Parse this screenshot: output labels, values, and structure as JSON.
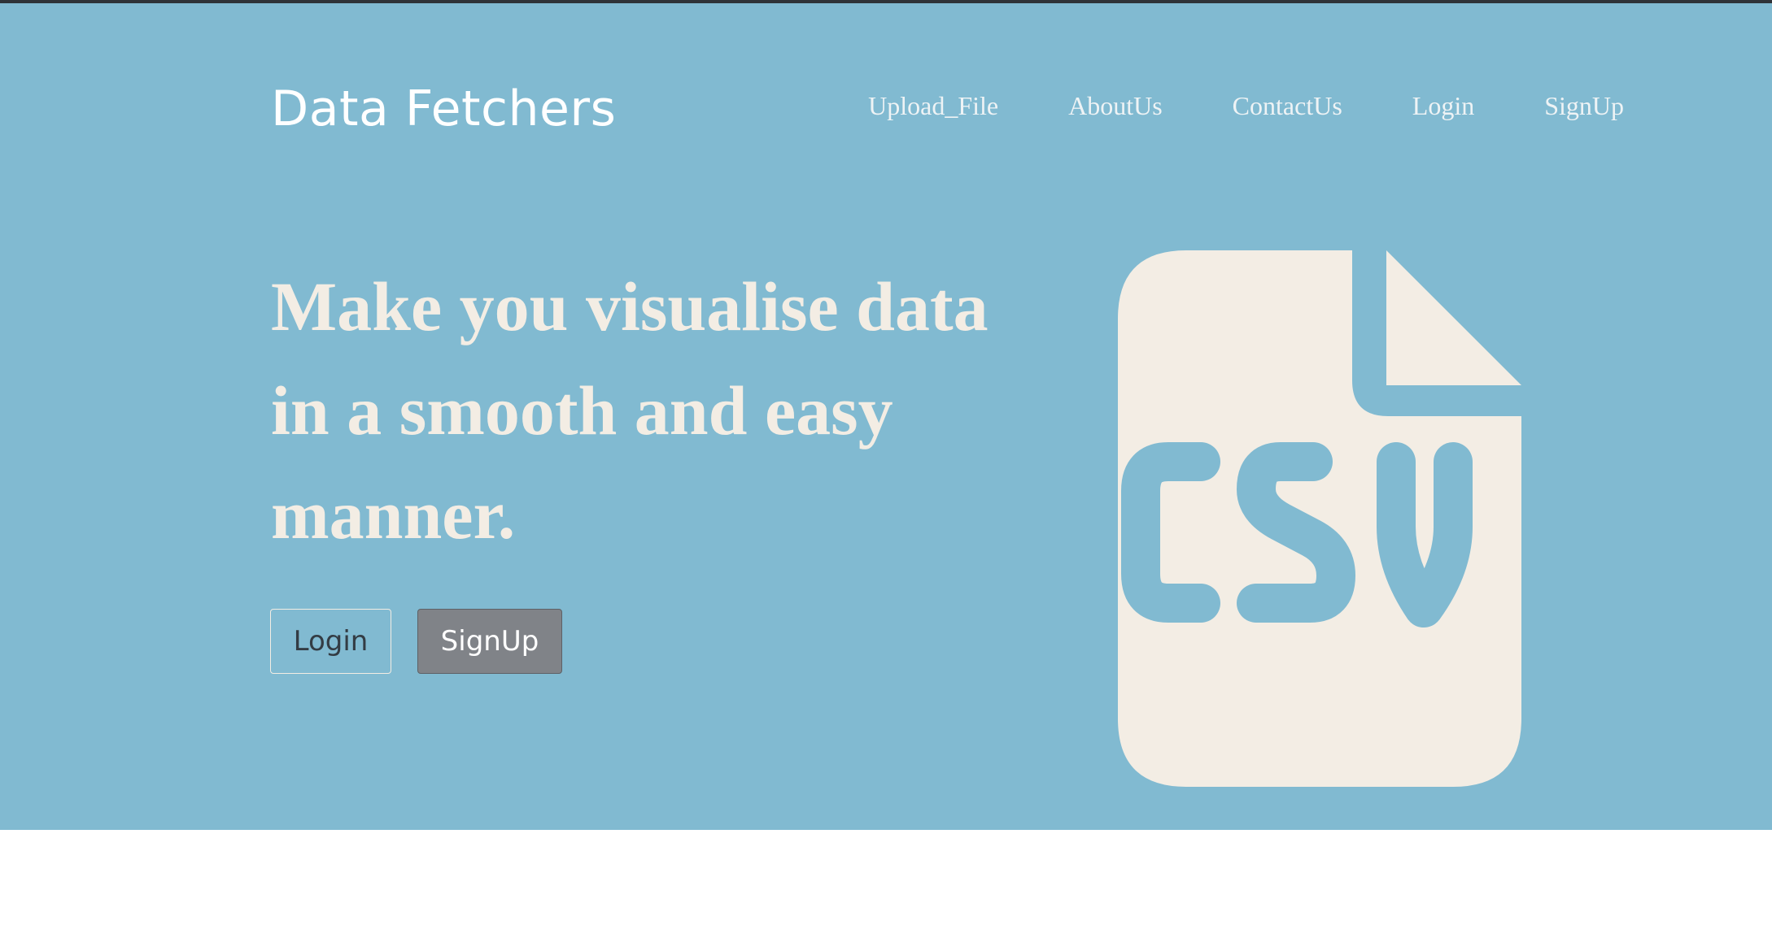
{
  "header": {
    "brand": "Data Fetchers",
    "nav": [
      {
        "label": "Upload_File"
      },
      {
        "label": "AboutUs"
      },
      {
        "label": "ContactUs"
      },
      {
        "label": "Login"
      },
      {
        "label": "SignUp"
      }
    ]
  },
  "hero": {
    "headline": "Make you visualise data in a smooth and easy manner.",
    "login_label": "Login",
    "signup_label": "SignUp",
    "illustration_icon": "csv-file-icon"
  },
  "colors": {
    "hero_background": "#81bad1",
    "headline": "#f3ede4",
    "signup_button": "#808388"
  }
}
